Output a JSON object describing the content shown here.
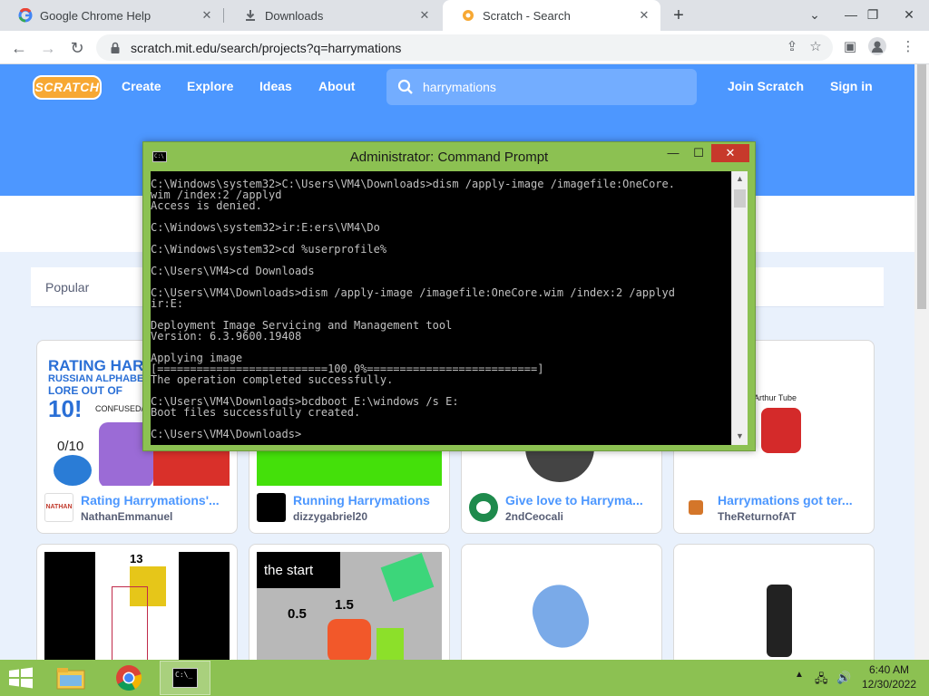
{
  "browser": {
    "tabs": [
      {
        "title": "Google Chrome Help"
      },
      {
        "title": "Downloads"
      },
      {
        "title": "Scratch - Search"
      }
    ],
    "url": "scratch.mit.edu/search/projects?q=harrymations"
  },
  "scratch": {
    "logo": "SCRATCH",
    "nav": [
      "Create",
      "Explore",
      "Ideas",
      "About"
    ],
    "search_value": "harrymations",
    "join": "Join Scratch",
    "signin": "Sign in",
    "tab_popular": "Popular",
    "projects": [
      {
        "title": "Rating Harrymations'...",
        "author": "NathanEmmanuel",
        "thumb_text": [
          "RATING HARR",
          "RUSSIAN ALPHABE",
          "LORE OUT OF",
          "10!",
          "CONFUSED/1",
          "0/10"
        ],
        "avatar_text": "NATHAN"
      },
      {
        "title": "Running Harrymations",
        "author": "dizzygabriel20"
      },
      {
        "title": "Give love to Harryma...",
        "author": "2ndCeocali"
      },
      {
        "title": "Harrymations got ter...",
        "author": "TheReturnofAT",
        "thumb_text": [
          "Arthur Tube"
        ]
      }
    ],
    "row2": [
      {
        "thumb_text": [
          "13"
        ]
      },
      {
        "thumb_text": [
          "the start",
          "0.5",
          "1.5"
        ]
      },
      {
        "thumb_text": []
      },
      {
        "thumb_text": []
      }
    ]
  },
  "cmd": {
    "title": "Administrator:  Command Prompt",
    "lines": [
      "C:\\Windows\\system32>C:\\Users\\VM4\\Downloads>dism /apply-image /imagefile:OneCore.",
      "wim /index:2 /applyd",
      "Access is denied.",
      "",
      "C:\\Windows\\system32>ir:E:ers\\VM4\\Do",
      "",
      "C:\\Windows\\system32>cd %userprofile%",
      "",
      "C:\\Users\\VM4>cd Downloads",
      "",
      "C:\\Users\\VM4\\Downloads>dism /apply-image /imagefile:OneCore.wim /index:2 /applyd",
      "ir:E:",
      "",
      "Deployment Image Servicing and Management tool",
      "Version: 6.3.9600.19408",
      "",
      "Applying image",
      "[==========================100.0%==========================]",
      "The operation completed successfully.",
      "",
      "C:\\Users\\VM4\\Downloads>bcdboot E:\\windows /s E:",
      "Boot files successfully created.",
      "",
      "C:\\Users\\VM4\\Downloads>"
    ]
  },
  "taskbar": {
    "time": "6:40 AM",
    "date": "12/30/2022"
  },
  "colors": {
    "scratch_blue": "#4c97ff",
    "win8_green": "#8cc152",
    "chrome_tabstrip": "#dee1e6"
  },
  "icons": {
    "tab1": "google-icon",
    "tab2": "download-icon",
    "tab3": "scratch-cat-icon",
    "cmd": "command-prompt-icon",
    "start": "windows-logo-icon"
  }
}
